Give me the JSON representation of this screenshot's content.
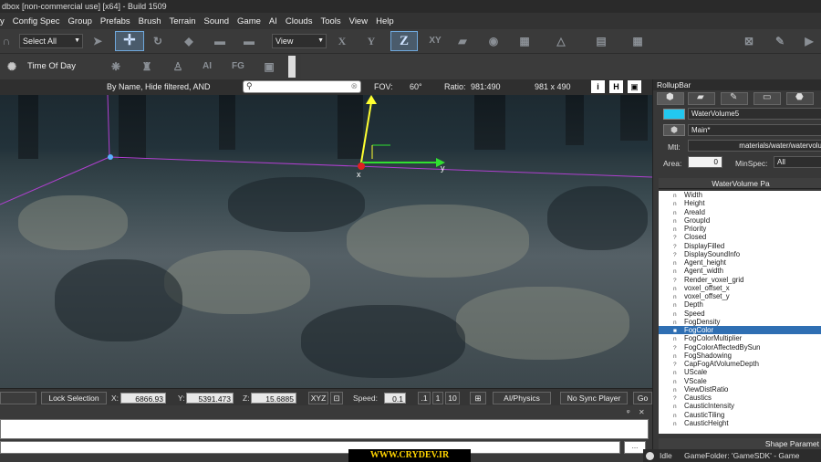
{
  "window": {
    "title": "dbox [non-commercial use] [x64] - Build 1509"
  },
  "menu": [
    "y",
    "Config Spec",
    "Group",
    "Prefabs",
    "Brush",
    "Terrain",
    "Sound",
    "Game",
    "AI",
    "Clouds",
    "Tools",
    "View",
    "Help"
  ],
  "toolbar": {
    "select_combo": "Select All",
    "view_combo": "View",
    "axis_x": "X",
    "axis_y": "Y",
    "axis_z": "Z",
    "axis_xy": "XY",
    "time_of_day": "Time Of Day",
    "ai_label": "AI",
    "fg_label": "FG"
  },
  "viewbar": {
    "filter_text": "By Name, Hide filtered, AND",
    "search_placeholder": "",
    "fov_label": "FOV:",
    "fov_value": "60°",
    "ratio_label": "Ratio:",
    "ratio_value": "981:490",
    "resolution": "981 x 490",
    "btn_i": "i",
    "btn_h": "H"
  },
  "gizmo": {
    "x": "x",
    "y": "y"
  },
  "statusbar": {
    "lock_selection": "Lock Selection",
    "x_label": "X:",
    "x_value": "6866.93",
    "y_label": "Y:",
    "y_value": "5391.473",
    "z_label": "Z:",
    "z_value": "15.6885",
    "xyz": "XYZ",
    "speed_label": "Speed:",
    "speed_value": "0.1",
    "speed_a": ".1",
    "speed_b": "1",
    "speed_c": "10",
    "ai_physics": "AI/Physics",
    "no_sync": "No Sync Player",
    "go": "Go"
  },
  "console": {
    "close": "✕",
    "pin": "ᵠ"
  },
  "watermark": "WWW.CRYDEV.IR",
  "bottom_status": {
    "state": "Idle",
    "game_folder": "GameFolder: 'GameSDK' - Game"
  },
  "rollup": {
    "title": "RollupBar",
    "object_name": "WaterVolume5",
    "layer": "Main*",
    "mtl_label": "Mtl:",
    "mtl_value": "materials/water/watervolu",
    "area_label": "Area:",
    "area_value": "0",
    "minspec_label": "MinSpec:",
    "minspec_value": "All",
    "params_header": "WaterVolume Pa",
    "shape_header": "Shape Paramet",
    "accent_color": "#22c8f0",
    "properties": [
      {
        "icon": "n",
        "name": "Width"
      },
      {
        "icon": "n",
        "name": "Height"
      },
      {
        "icon": "n",
        "name": "AreaId"
      },
      {
        "icon": "n",
        "name": "GroupId"
      },
      {
        "icon": "n",
        "name": "Priority"
      },
      {
        "icon": "?",
        "name": "Closed"
      },
      {
        "icon": "?",
        "name": "DisplayFilled"
      },
      {
        "icon": "?",
        "name": "DisplaySoundInfo"
      },
      {
        "icon": "n",
        "name": "Agent_height"
      },
      {
        "icon": "n",
        "name": "Agent_width"
      },
      {
        "icon": "?",
        "name": "Render_voxel_grid"
      },
      {
        "icon": "n",
        "name": "voxel_offset_x"
      },
      {
        "icon": "n",
        "name": "voxel_offset_y"
      },
      {
        "icon": "n",
        "name": "Depth"
      },
      {
        "icon": "n",
        "name": "Speed"
      },
      {
        "icon": "n",
        "name": "FogDensity"
      },
      {
        "icon": "■",
        "name": "FogColor",
        "selected": true
      },
      {
        "icon": "n",
        "name": "FogColorMultiplier"
      },
      {
        "icon": "?",
        "name": "FogColorAffectedBySun"
      },
      {
        "icon": "n",
        "name": "FogShadowing"
      },
      {
        "icon": "?",
        "name": "CapFogAtVolumeDepth"
      },
      {
        "icon": "n",
        "name": "UScale"
      },
      {
        "icon": "n",
        "name": "VScale"
      },
      {
        "icon": "n",
        "name": "ViewDistRatio"
      },
      {
        "icon": "?",
        "name": "Caustics"
      },
      {
        "icon": "n",
        "name": "CausticIntensity"
      },
      {
        "icon": "n",
        "name": "CausticTiling"
      },
      {
        "icon": "n",
        "name": "CausticHeight"
      }
    ]
  }
}
